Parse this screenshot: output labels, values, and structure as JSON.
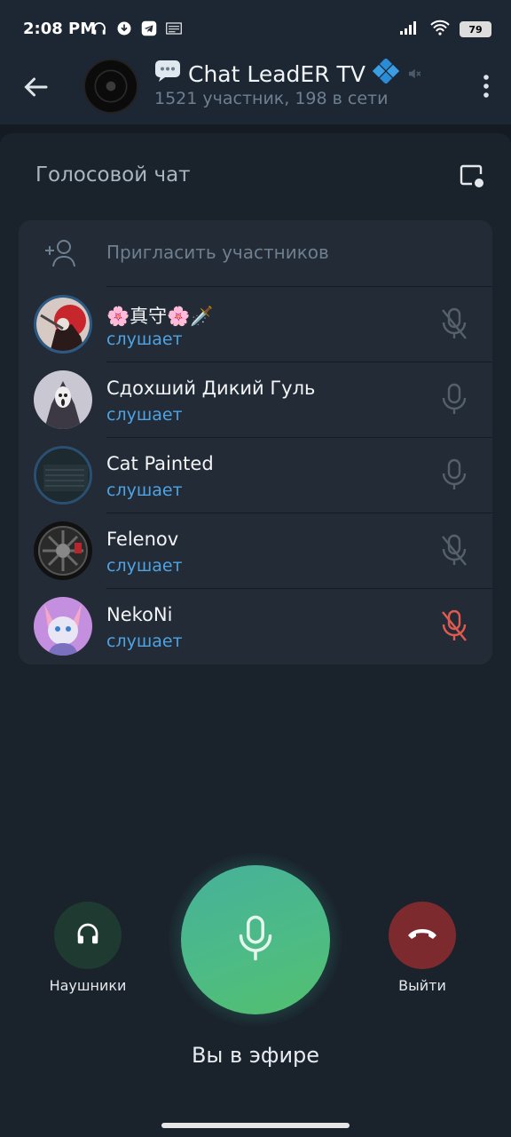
{
  "status_bar": {
    "time": "2:08 PM",
    "icons": [
      "headphones-icon",
      "download-icon",
      "telegram-icon",
      "news-icon"
    ],
    "right_icons": [
      "signal-icon",
      "wifi-icon"
    ],
    "battery": "79"
  },
  "header": {
    "chat_title": "Chat LeadER TV",
    "subtitle": "1521 участник, 198 в сети",
    "title_prefix_icon": "speech-bubble-icon",
    "title_suffix_icon": "diamond-icon",
    "muted_icon": "mute-icon"
  },
  "voice_chat": {
    "title": "Голосовой чат",
    "invite_label": "Пригласить участников",
    "participants": [
      {
        "name": "🌸真守🌸🗡️",
        "status": "слушает",
        "mic": "muted",
        "mic_color": "#56606b"
      },
      {
        "name": "Сдохший Дикий Гуль",
        "status": "слушает",
        "mic": "on",
        "mic_color": "#56606b"
      },
      {
        "name": "Cat Painted",
        "status": "слушает",
        "mic": "on",
        "mic_color": "#56606b"
      },
      {
        "name": "Felenov",
        "status": "слушает",
        "mic": "muted",
        "mic_color": "#56606b"
      },
      {
        "name": "NekoNi",
        "status": "слушает",
        "mic": "muted",
        "mic_color": "#e05a50"
      }
    ]
  },
  "controls": {
    "headphones_label": "Наушники",
    "leave_label": "Выйти",
    "on_air_label": "Вы в эфире"
  },
  "colors": {
    "accent_blue": "#4fa3e3",
    "mic_green": "#4dbb86",
    "leave_red": "#7d2a2f"
  }
}
